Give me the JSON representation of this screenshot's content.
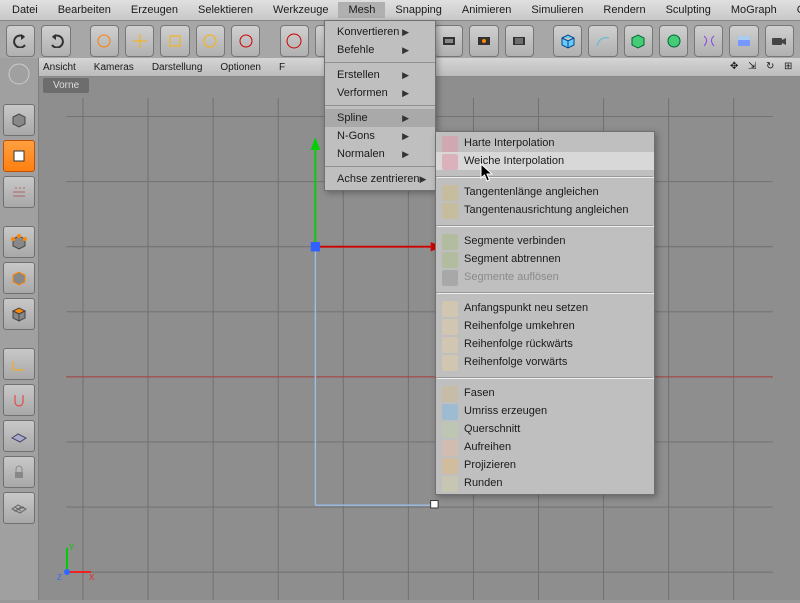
{
  "menubar": [
    "Datei",
    "Bearbeiten",
    "Erzeugen",
    "Selektieren",
    "Werkzeuge",
    "Mesh",
    "Snapping",
    "Animieren",
    "Simulieren",
    "Rendern",
    "Sculpting",
    "MoGraph",
    "Charak"
  ],
  "menubar_open_index": 5,
  "viewport_menu": [
    "Ansicht",
    "Kameras",
    "Darstellung",
    "Optionen",
    "F"
  ],
  "viewport_tab": "Vorne",
  "dropdown": {
    "items": [
      {
        "label": "Konvertieren",
        "sub": true
      },
      {
        "label": "Befehle",
        "sub": true
      },
      {
        "sep": true
      },
      {
        "label": "Erstellen",
        "sub": true
      },
      {
        "label": "Verformen",
        "sub": true
      },
      {
        "sep": true
      },
      {
        "label": "Spline",
        "sub": true,
        "hl": true
      },
      {
        "label": "N-Gons",
        "sub": true
      },
      {
        "label": "Normalen",
        "sub": true
      },
      {
        "sep": true
      },
      {
        "label": "Achse zentrieren",
        "sub": true
      }
    ]
  },
  "submenu": {
    "items": [
      {
        "label": "Harte Interpolation"
      },
      {
        "label": "Weiche Interpolation",
        "hl": true
      },
      {
        "sep": true
      },
      {
        "label": "Tangentenlänge angleichen"
      },
      {
        "label": "Tangentenausrichtung angleichen"
      },
      {
        "sep": true
      },
      {
        "label": "Segmente verbinden"
      },
      {
        "label": "Segment abtrennen"
      },
      {
        "label": "Segmente auflösen",
        "dis": true
      },
      {
        "sep": true
      },
      {
        "label": "Anfangspunkt neu setzen"
      },
      {
        "label": "Reihenfolge umkehren"
      },
      {
        "label": "Reihenfolge rückwärts"
      },
      {
        "label": "Reihenfolge vorwärts"
      },
      {
        "sep": true
      },
      {
        "label": "Fasen"
      },
      {
        "label": "Umriss erzeugen"
      },
      {
        "label": "Querschnitt"
      },
      {
        "label": "Aufreihen"
      },
      {
        "label": "Projizieren"
      },
      {
        "label": "Runden"
      }
    ]
  },
  "axis_labels": {
    "x": "X",
    "y": "Y",
    "z": "Z"
  }
}
